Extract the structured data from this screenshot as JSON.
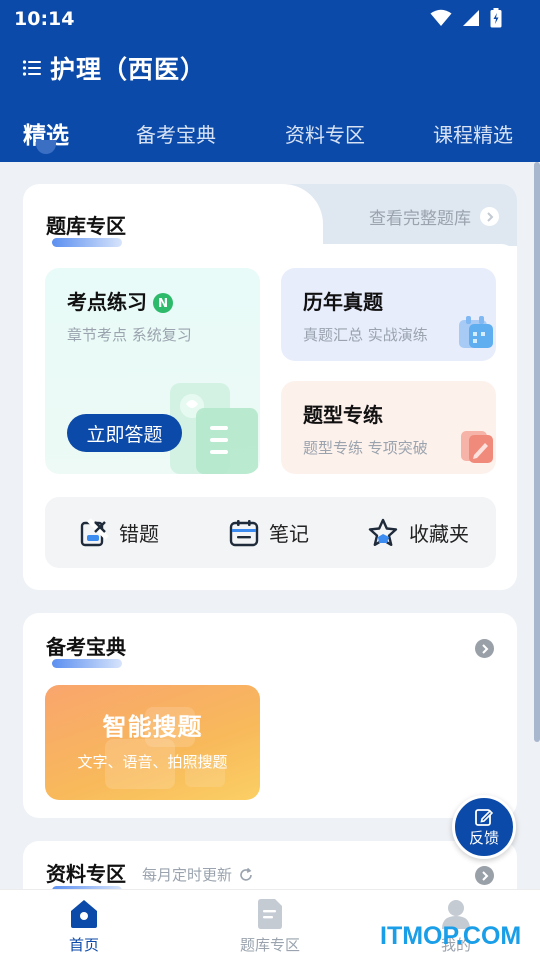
{
  "status": {
    "time": "10:14"
  },
  "header": {
    "title": "护理（西医）",
    "tabs": [
      {
        "label": "精选",
        "active": true
      },
      {
        "label": "备考宝典",
        "active": false
      },
      {
        "label": "资料专区",
        "active": false
      },
      {
        "label": "课程精选",
        "active": false
      }
    ]
  },
  "question_bank": {
    "title": "题库专区",
    "view_all": "查看完整题库",
    "kaodian": {
      "title": "考点练习",
      "badge": "N",
      "subtitle": "章节考点 系统复习",
      "button": "立即答题"
    },
    "linian": {
      "title": "历年真题",
      "subtitle": "真题汇总 实战演练"
    },
    "tixing": {
      "title": "题型专练",
      "subtitle": "题型专练 专项突破"
    },
    "quick": [
      {
        "label": "错题",
        "icon": "wrong-question-icon"
      },
      {
        "label": "笔记",
        "icon": "notes-icon"
      },
      {
        "label": "收藏夹",
        "icon": "star-icon"
      }
    ]
  },
  "guide": {
    "title": "备考宝典",
    "smart_search": {
      "title": "智能搜题",
      "subtitle": "文字、语音、拍照搜题"
    }
  },
  "materials": {
    "title": "资料专区",
    "update_text": "每月定时更新"
  },
  "feedback": {
    "label": "反馈"
  },
  "bottom_nav": [
    {
      "label": "首页",
      "active": true,
      "icon": "home-icon"
    },
    {
      "label": "题库专区",
      "active": false,
      "icon": "document-icon"
    },
    {
      "label": "我的",
      "active": false,
      "icon": "user-icon"
    }
  ],
  "watermark": "ITMOP.COM",
  "colors": {
    "primary": "#0b4aa8",
    "accent_green": "#2dbb6b",
    "smart_orange": "#f9a56d"
  }
}
